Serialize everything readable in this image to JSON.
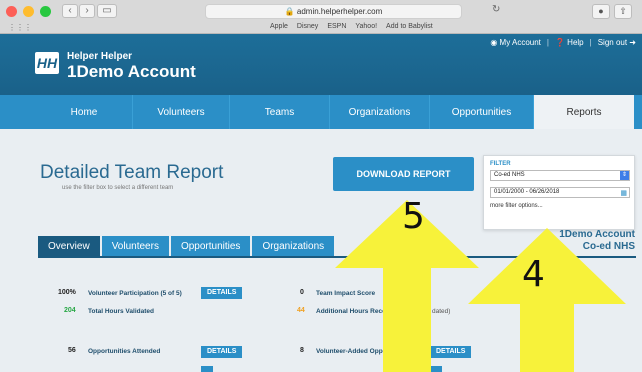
{
  "browser": {
    "url": "admin.helperhelper.com",
    "bookmarks": [
      "Apple",
      "Disney",
      "ESPN",
      "Yahoo!",
      "Add to Babylist"
    ]
  },
  "header": {
    "brand_top": "Helper Helper",
    "brand": "1Demo Account",
    "my_account": "My Account",
    "help": "Help",
    "sign_out": "Sign out"
  },
  "nav": {
    "items": [
      "Home",
      "Volunteers",
      "Teams",
      "Organizations",
      "Opportunities",
      "Reports"
    ]
  },
  "page": {
    "title": "Detailed Team Report",
    "subtitle": "use the filter box to select a different team",
    "download": "DOWNLOAD REPORT"
  },
  "filter": {
    "label": "FILTER",
    "team": "Co-ed NHS",
    "dates": "01/01/2000 - 06/26/2018",
    "more": "more filter options..."
  },
  "account": {
    "name": "1Demo Account",
    "team": "Co-ed NHS"
  },
  "tabs": [
    "Overview",
    "Volunteers",
    "Opportunities",
    "Organizations"
  ],
  "stats": {
    "participation_num": "100%",
    "participation_label": "Volunteer Participation (5 of 5)",
    "impact_num": "0",
    "impact_label": "Team Impact Score",
    "hours_num": "204",
    "hours_label": "Total Hours Validated",
    "addl_num": "44",
    "addl_label": "Additional Hours Recorde",
    "addl_suffix": "dated)",
    "attended_num": "56",
    "attended_label": "Opportunities Attended",
    "added_num": "8",
    "added_label": "Volunteer-Added Opportunities",
    "details": "DETAILS"
  },
  "annotations": {
    "five": "5",
    "four": "4",
    "arrow_color": "#f7f23a"
  }
}
